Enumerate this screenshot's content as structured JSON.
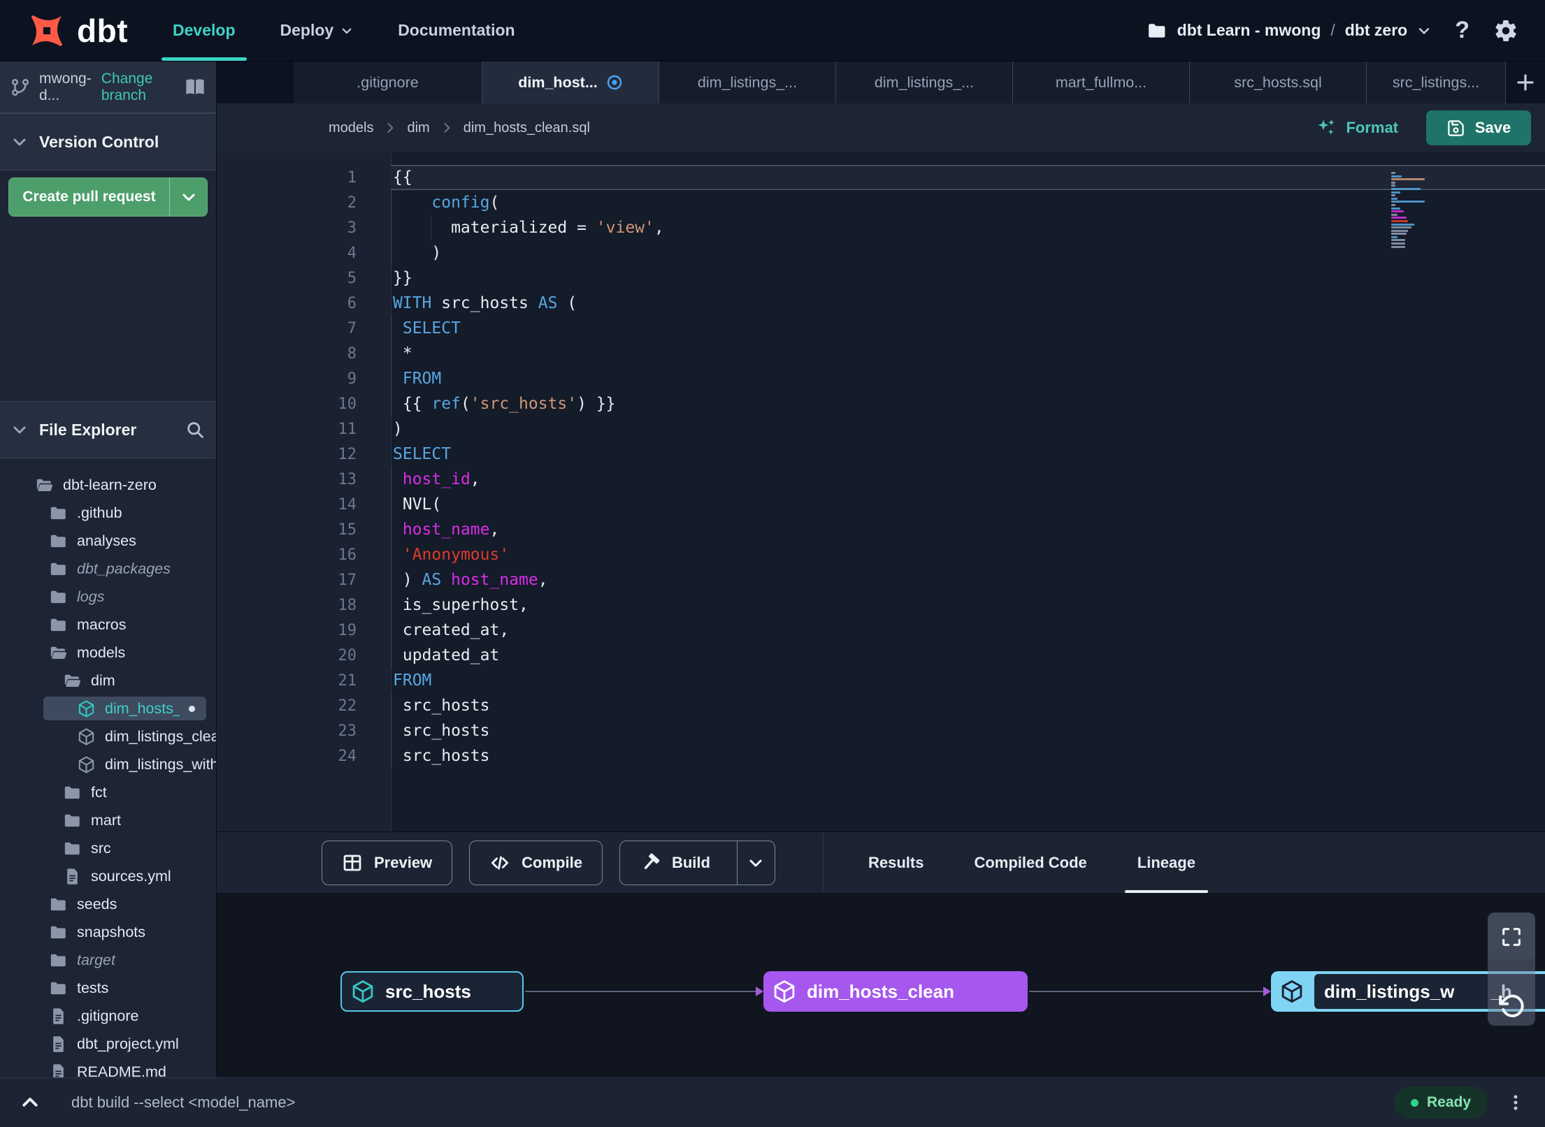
{
  "colors": {
    "accent_teal": "#3bd3c4",
    "brand_orange": "#ff5a46",
    "create_pr_green": "#4c9e6b",
    "save_button_teal": "#1e7468",
    "modified_blue": "#4da3f5",
    "node_purple": "#a557ee",
    "node_blue": "#7fd4f4",
    "node_source_border": "#58c7e8",
    "status_ready_green": "#2ed289",
    "syntax_keyword": "#58a6e2",
    "syntax_identifier": "#d92ee8",
    "syntax_string": "#cf9878",
    "syntax_string_red": "#df3c2a"
  },
  "navbar": {
    "logo_text": "dbt",
    "nav_items": [
      {
        "label": "Develop",
        "active": true
      },
      {
        "label": "Deploy",
        "has_chevron": true
      },
      {
        "label": "Documentation"
      }
    ],
    "project": {
      "account": "dbt Learn - mwong",
      "separator": "/",
      "project_name": "dbt zero"
    },
    "help_label": "?"
  },
  "sidebar": {
    "branch": {
      "name": "mwong-d...",
      "change_link": "Change branch"
    },
    "version_control": {
      "title": "Version Control",
      "create_pr_label": "Create pull request"
    },
    "file_explorer": {
      "title": "File Explorer",
      "tree": [
        {
          "label": "dbt-learn-zero",
          "type": "folder-open",
          "level": 0
        },
        {
          "label": ".github",
          "type": "folder",
          "level": 1
        },
        {
          "label": "analyses",
          "type": "folder",
          "level": 1
        },
        {
          "label": "dbt_packages",
          "type": "folder",
          "level": 1,
          "italic": true
        },
        {
          "label": "logs",
          "type": "folder",
          "level": 1,
          "italic": true
        },
        {
          "label": "macros",
          "type": "folder",
          "level": 1
        },
        {
          "label": "models",
          "type": "folder-open",
          "level": 1
        },
        {
          "label": "dim",
          "type": "folder-open",
          "level": 2
        },
        {
          "label": "dim_hosts_clean.sql",
          "type": "model",
          "level": 3,
          "selected": true,
          "modified": true
        },
        {
          "label": "dim_listings_clean.sql",
          "type": "model",
          "level": 3
        },
        {
          "label": "dim_listings_with_hosts...",
          "type": "model",
          "level": 3
        },
        {
          "label": "fct",
          "type": "folder",
          "level": 2
        },
        {
          "label": "mart",
          "type": "folder",
          "level": 2
        },
        {
          "label": "src",
          "type": "folder",
          "level": 2
        },
        {
          "label": "sources.yml",
          "type": "file",
          "level": 2
        },
        {
          "label": "seeds",
          "type": "folder",
          "level": 1
        },
        {
          "label": "snapshots",
          "type": "folder",
          "level": 1
        },
        {
          "label": "target",
          "type": "folder",
          "level": 1,
          "italic": true
        },
        {
          "label": "tests",
          "type": "folder",
          "level": 1
        },
        {
          "label": ".gitignore",
          "type": "file",
          "level": 1
        },
        {
          "label": "dbt_project.yml",
          "type": "file",
          "level": 1
        },
        {
          "label": "README.md",
          "type": "file",
          "level": 1
        }
      ]
    }
  },
  "tabs": [
    {
      "label": ".gitignore"
    },
    {
      "label": "dim_host...",
      "active": true,
      "modified": true
    },
    {
      "label": "dim_listings_..."
    },
    {
      "label": "dim_listings_..."
    },
    {
      "label": "mart_fullmo..."
    },
    {
      "label": "src_hosts.sql"
    },
    {
      "label": "src_listings..."
    }
  ],
  "editor_header": {
    "breadcrumb": [
      "models",
      "dim",
      "dim_hosts_clean.sql"
    ],
    "format_label": "Format",
    "save_label": "Save"
  },
  "editor": {
    "lines": [
      {
        "num": 1,
        "current": true,
        "tokens": [
          {
            "t": "{{",
            "c": "plain"
          }
        ]
      },
      {
        "num": 2,
        "tokens": [
          {
            "t": "    ",
            "c": "plain"
          },
          {
            "t": "config",
            "c": "kw"
          },
          {
            "t": "(",
            "c": "plain"
          }
        ]
      },
      {
        "num": 3,
        "tokens": [
          {
            "t": "      materialized = ",
            "c": "plain"
          },
          {
            "t": "'view'",
            "c": "str"
          },
          {
            "t": ",",
            "c": "plain"
          }
        ]
      },
      {
        "num": 4,
        "tokens": [
          {
            "t": "    )",
            "c": "plain"
          }
        ]
      },
      {
        "num": 5,
        "tokens": [
          {
            "t": "}}",
            "c": "plain"
          }
        ]
      },
      {
        "num": 6,
        "tokens": [
          {
            "t": "WITH",
            "c": "kw"
          },
          {
            "t": " src_hosts ",
            "c": "plain"
          },
          {
            "t": "AS",
            "c": "kw"
          },
          {
            "t": " (",
            "c": "plain"
          }
        ]
      },
      {
        "num": 7,
        "tokens": [
          {
            "t": " ",
            "c": "plain"
          },
          {
            "t": "SELECT",
            "c": "kw"
          }
        ]
      },
      {
        "num": 8,
        "tokens": [
          {
            "t": " *",
            "c": "plain"
          }
        ]
      },
      {
        "num": 9,
        "tokens": [
          {
            "t": " ",
            "c": "plain"
          },
          {
            "t": "FROM",
            "c": "kw"
          }
        ]
      },
      {
        "num": 10,
        "tokens": [
          {
            "t": " {{ ",
            "c": "plain"
          },
          {
            "t": "ref",
            "c": "kw"
          },
          {
            "t": "(",
            "c": "plain"
          },
          {
            "t": "'src_hosts'",
            "c": "str"
          },
          {
            "t": ") }}",
            "c": "plain"
          }
        ]
      },
      {
        "num": 11,
        "tokens": [
          {
            "t": ")",
            "c": "plain"
          }
        ]
      },
      {
        "num": 12,
        "tokens": [
          {
            "t": "SELECT",
            "c": "kw"
          }
        ]
      },
      {
        "num": 13,
        "tokens": [
          {
            "t": " ",
            "c": "plain"
          },
          {
            "t": "host_id",
            "c": "ident"
          },
          {
            "t": ",",
            "c": "plain"
          }
        ]
      },
      {
        "num": 14,
        "tokens": [
          {
            "t": " NVL(",
            "c": "plain"
          }
        ]
      },
      {
        "num": 15,
        "tokens": [
          {
            "t": " ",
            "c": "plain"
          },
          {
            "t": "host_name",
            "c": "ident"
          },
          {
            "t": ",",
            "c": "plain"
          }
        ]
      },
      {
        "num": 16,
        "tokens": [
          {
            "t": " ",
            "c": "plain"
          },
          {
            "t": "'Anonymous'",
            "c": "strred"
          }
        ]
      },
      {
        "num": 17,
        "tokens": [
          {
            "t": " ) ",
            "c": "plain"
          },
          {
            "t": "AS",
            "c": "kw"
          },
          {
            "t": " ",
            "c": "plain"
          },
          {
            "t": "host_name",
            "c": "ident"
          },
          {
            "t": ",",
            "c": "plain"
          }
        ]
      },
      {
        "num": 18,
        "tokens": [
          {
            "t": " is_superhost,",
            "c": "plain"
          }
        ]
      },
      {
        "num": 19,
        "tokens": [
          {
            "t": " created_at,",
            "c": "plain"
          }
        ]
      },
      {
        "num": 20,
        "tokens": [
          {
            "t": " updated_at",
            "c": "plain"
          }
        ]
      },
      {
        "num": 21,
        "tokens": [
          {
            "t": "FROM",
            "c": "kw"
          }
        ]
      },
      {
        "num": 22,
        "tokens": [
          {
            "t": " src_hosts",
            "c": "plain"
          }
        ]
      },
      {
        "num": 23,
        "tokens": [
          {
            "t": " src_hosts",
            "c": "plain"
          }
        ]
      },
      {
        "num": 24,
        "tokens": [
          {
            "t": " src_hosts",
            "c": "plain"
          }
        ]
      }
    ]
  },
  "bottom_panel": {
    "actions": [
      {
        "label": "Preview",
        "icon": "table"
      },
      {
        "label": "Compile",
        "icon": "code"
      },
      {
        "label": "Build",
        "icon": "hammer",
        "split": true
      }
    ],
    "tabs": [
      {
        "label": "Results"
      },
      {
        "label": "Compiled Code"
      },
      {
        "label": "Lineage",
        "active": true
      }
    ]
  },
  "lineage": {
    "nodes": [
      {
        "label": "src_hosts",
        "style": "source"
      },
      {
        "label": "dim_hosts_clean",
        "style": "purple"
      },
      {
        "label": "dim_listings_w",
        "label_suffix": "_h",
        "style": "selected"
      }
    ]
  },
  "statusbar": {
    "command": "dbt build --select <model_name>",
    "status": "Ready"
  }
}
